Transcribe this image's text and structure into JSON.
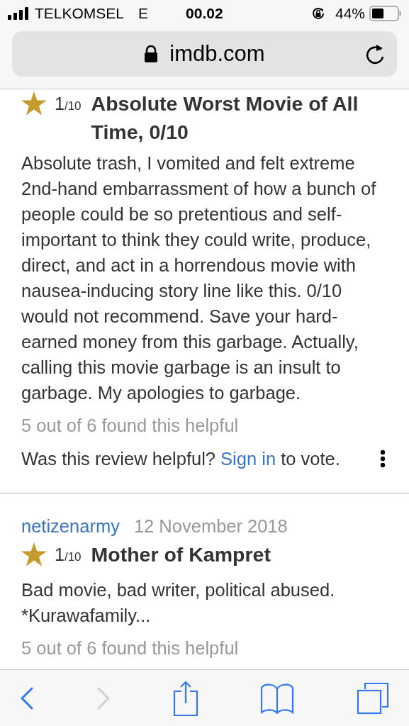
{
  "status_bar": {
    "carrier": "TELKOMSEL",
    "network": "E",
    "time": "00.02",
    "battery": "44%"
  },
  "address_bar": {
    "url": "imdb.com"
  },
  "reviews": [
    {
      "rating": "1",
      "rating_scale": "/10",
      "title": "Absolute Worst Movie of All Time, 0/10",
      "body": "Absolute trash, I vomited and felt extreme 2nd-hand embarrassment of how a bunch of people could be so pretentious and self-important to think they could write, produce, direct, and act in a horrendous movie with nausea-inducing story line like this. 0/10 would not recommend. Save your hard-earned money from this garbage. Actually, calling this movie garbage is an insult to garbage. My apologies to garbage.",
      "helpful": "5 out of 6 found this helpful",
      "vote": {
        "before": "Was this review helpful?",
        "link": "Sign in",
        "after": "to vote."
      }
    },
    {
      "author": "netizenarmy",
      "date": "12 November 2018",
      "rating": "1",
      "rating_scale": "/10",
      "title": "Mother of Kampret",
      "body": "Bad movie, bad writer, political abused. *Kurawafamily...",
      "helpful": "5 out of 6 found this helpful"
    }
  ],
  "toolbar": [
    {
      "kind": "back",
      "disabled": false
    },
    {
      "kind": "forward",
      "disabled": true
    },
    {
      "kind": "share",
      "disabled": false
    },
    {
      "kind": "bookmarks",
      "disabled": false
    },
    {
      "kind": "tabs",
      "disabled": false
    }
  ]
}
